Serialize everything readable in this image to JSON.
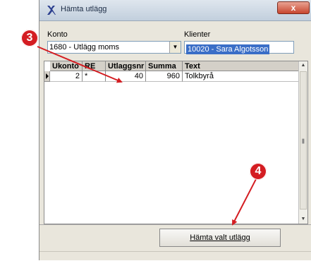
{
  "window": {
    "title": "Hämta utlägg",
    "close_label": "x"
  },
  "form": {
    "konto_label": "Konto",
    "konto_value": "1680 - Utlägg moms",
    "klienter_label": "Klienter",
    "klienter_value": "10020 - Sara Algotsson"
  },
  "grid": {
    "columns": [
      "Ukonto",
      "RE",
      "Utlaggsnr",
      "Summa",
      "Text"
    ],
    "rows": [
      {
        "ukonto": "2",
        "re": "*",
        "utlaggsnr": "40",
        "summa": "960",
        "text": "Tolkbyrå"
      }
    ]
  },
  "button": {
    "fetch_label": "Hämta valt utlägg"
  },
  "annotations": {
    "marker_3": "3",
    "marker_4": "4"
  },
  "colors": {
    "marker": "#d41d22",
    "arrow": "#d41d22",
    "selection": "#3a6ec7"
  }
}
